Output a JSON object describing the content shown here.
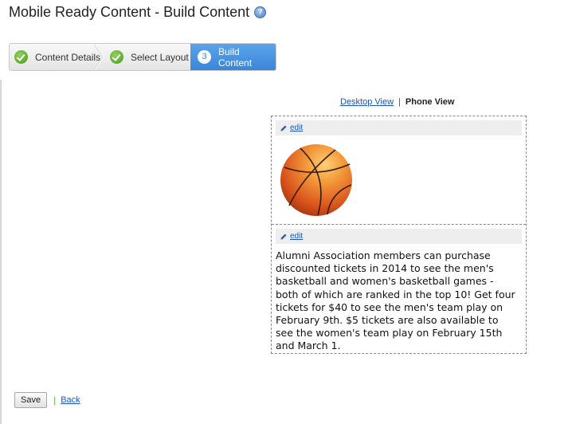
{
  "page": {
    "title": "Mobile Ready Content - Build Content",
    "help_icon": "question-circle-icon",
    "help_glyph": "?"
  },
  "wizard": {
    "steps": [
      {
        "label": "Content Details",
        "state": "complete",
        "icon": "check-icon"
      },
      {
        "label": "Select Layout",
        "state": "complete",
        "icon": "check-icon"
      },
      {
        "label": "Build Content",
        "state": "current",
        "number": "3"
      }
    ],
    "colors": {
      "complete": "#4a9a1d",
      "current": "#3b86d9"
    }
  },
  "view_toggle": {
    "desktop_label": "Desktop View",
    "separator": "|",
    "phone_label": "Phone View",
    "selected": "Phone View"
  },
  "preview": {
    "blocks": [
      {
        "type": "image",
        "edit_label": "edit",
        "image_icon": "basketball-image"
      },
      {
        "type": "text",
        "edit_label": "edit",
        "text": "Alumni Association members can purchase discounted tickets in 2014 to see the men's basketball and women's basketball games - both of which are ranked in the top 10! Get four tickets for $40 to see the men's team play on February 9th. $5 tickets are also available to see the women's team play on February 15th and March 1."
      }
    ]
  },
  "footer": {
    "save_label": "Save",
    "separator": "|",
    "back_label": "Back"
  }
}
